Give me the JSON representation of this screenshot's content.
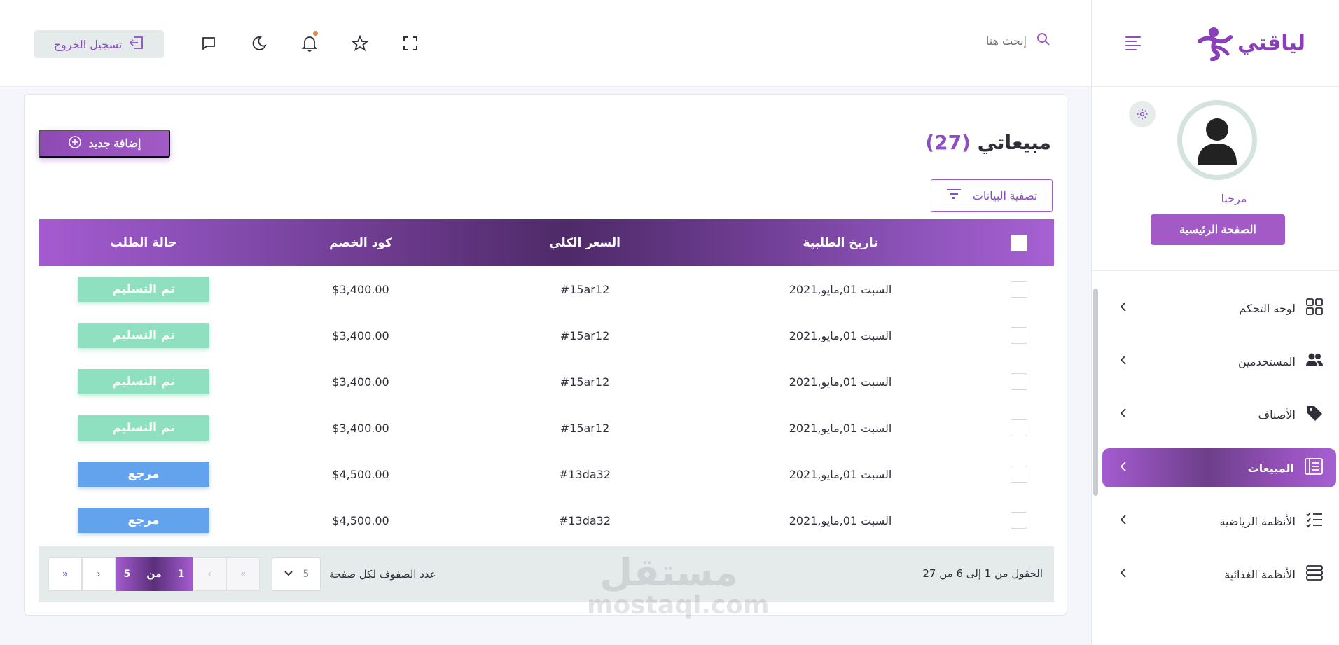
{
  "brand": {
    "name": "لياقتي",
    "logo_icon": "runner-logo-icon",
    "accent": "#8a4fc0"
  },
  "topbar": {
    "search_placeholder": "إبحث هنا",
    "logout_label": "تسجيل الخروج",
    "icons": [
      "search-icon",
      "fullscreen-icon",
      "star-icon",
      "bell-icon",
      "moon-icon",
      "chat-icon",
      "logout-icon"
    ]
  },
  "profile": {
    "welcome": "مرحبا",
    "home_button": "الصفحة الرئيسية"
  },
  "sidebar": {
    "items": [
      {
        "label": "لوحة التحكم",
        "icon": "grid-icon"
      },
      {
        "label": "المستخدمين",
        "icon": "users-icon"
      },
      {
        "label": "الأصناف",
        "icon": "tag-icon"
      },
      {
        "label": "المبيعات",
        "icon": "sales-icon",
        "active": true
      },
      {
        "label": "الأنظمة الرياضية",
        "icon": "checklist-icon"
      },
      {
        "label": "الأنظمة الغذائية",
        "icon": "server-icon"
      }
    ]
  },
  "main": {
    "title": "مبيعاتي",
    "count": "(27)",
    "add_button": "إضافة جديد",
    "filter_button": "تصفية البيانات",
    "table": {
      "headers": [
        "تاريخ الطلبية",
        "السعر الكلي",
        "كود الخصم",
        "حالة الطلب"
      ],
      "rows": [
        {
          "date": "السبت 01,مايو,2021",
          "code": "#15ar12",
          "price": "$3,400.00",
          "status": "تم التسليم",
          "status_type": "delivered"
        },
        {
          "date": "السبت 01,مايو,2021",
          "code": "#15ar12",
          "price": "$3,400.00",
          "status": "تم التسليم",
          "status_type": "delivered"
        },
        {
          "date": "السبت 01,مايو,2021",
          "code": "#15ar12",
          "price": "$3,400.00",
          "status": "تم التسليم",
          "status_type": "delivered"
        },
        {
          "date": "السبت 01,مايو,2021",
          "code": "#15ar12",
          "price": "$3,400.00",
          "status": "تم التسليم",
          "status_type": "delivered"
        },
        {
          "date": "السبت 01,مايو,2021",
          "code": "#13da32",
          "price": "$4,500.00",
          "status": "مرجع",
          "status_type": "returned"
        },
        {
          "date": "السبت 01,مايو,2021",
          "code": "#13da32",
          "price": "$4,500.00",
          "status": "مرجع",
          "status_type": "returned"
        }
      ]
    },
    "pagination": {
      "range_text": "الحقول من 1 إلى 6 من 27",
      "per_page_label": "عدد الصفوف لكل صفحة",
      "per_page_value": "5",
      "current_page": "1",
      "of_label": "من",
      "total_pages": "5"
    }
  },
  "watermark": {
    "arabic": "مستقل",
    "latin": "mostaql.com"
  },
  "colors": {
    "delivered": "#8fe0c1",
    "returned": "#63a2ec",
    "primary": "#a25bc6"
  }
}
